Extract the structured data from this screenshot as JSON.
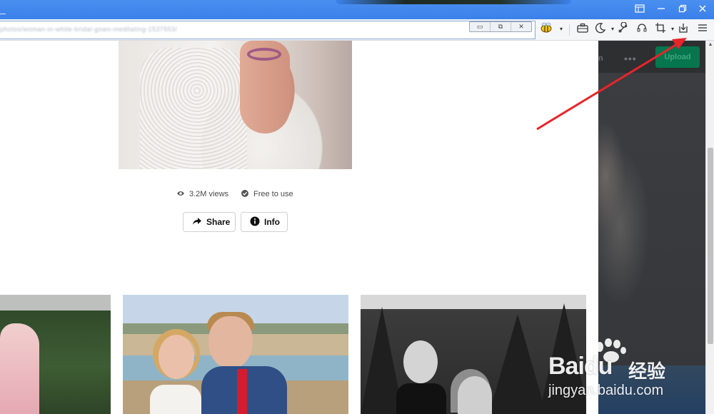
{
  "window": {
    "controls": [
      "sidebar-toggle",
      "minimize",
      "restore",
      "close"
    ],
    "accent_color": "#3a80ea"
  },
  "address_bar": {
    "url": "photos/woman-in-white-bridal-gown-meditating-1537553/",
    "mini_controls": [
      "▭",
      "⧉",
      "✕"
    ]
  },
  "toolbar": {
    "icons": [
      "extension-bee-icon",
      "chevron-down-icon",
      "briefcase-icon",
      "night-mode-icon",
      "wrench-icon",
      "headset-icon",
      "screenshot-crop-icon",
      "download-icon",
      "menu-icon"
    ]
  },
  "photo": {
    "views": "3.2M views",
    "license": "Free to use",
    "share_label": "Share",
    "info_label": "Info"
  },
  "overlay": {
    "nav_text": "n",
    "more": "•••",
    "upload_label": "Upload",
    "upload_color": "#05764d"
  },
  "annotation": {
    "arrow_color": "#e8252a"
  },
  "watermark": {
    "logo": "Baidu",
    "cn": "经验",
    "domain": "jingyan.baidu.com"
  }
}
